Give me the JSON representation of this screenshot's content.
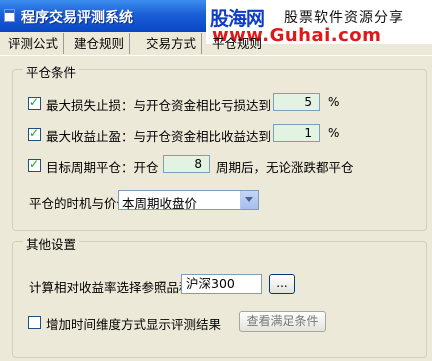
{
  "window": {
    "title": "程序交易评测系统"
  },
  "watermark": {
    "logo": "股海网",
    "slogan": "股票软件资源分享",
    "url": "www.Guhai.com"
  },
  "tabs": [
    "评测公式",
    "建仓规则",
    "交易方式",
    "平仓规则"
  ],
  "close_group": {
    "title": "平仓条件",
    "stop_loss": {
      "checked": true,
      "label": "最大损失止损：与开仓资金相比亏损达到",
      "value": "5",
      "unit": "%"
    },
    "take_profit": {
      "checked": true,
      "label": "最大收益止盈：与开仓资金相比收益达到",
      "value": "1",
      "unit": "%"
    },
    "period_close": {
      "checked": true,
      "label": "目标周期平仓：开仓",
      "value": "8",
      "suffix": "周期后，无论涨跌都平仓"
    },
    "timing": {
      "label": "平仓的时机与价位",
      "selected": "本周期收盘价"
    }
  },
  "other_group": {
    "title": "其他设置",
    "benchmark": {
      "label": "计算相对收益率选择参照品种",
      "value": "沪深300",
      "button": "..."
    },
    "time_dimension": {
      "checked": false,
      "label": "增加时间维度方式显示评测结果"
    },
    "view_button": "查看满足条件"
  }
}
